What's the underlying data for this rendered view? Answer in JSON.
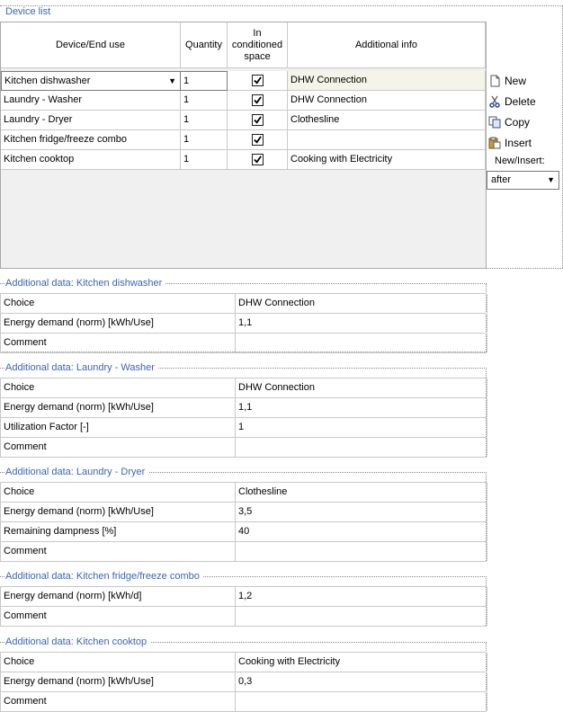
{
  "device_list": {
    "title": "Device list",
    "columns": [
      "Device/End use",
      "Quantity",
      "In conditioned space",
      "Additional info"
    ],
    "rows": [
      {
        "device": "Kitchen dishwasher",
        "quantity": "1",
        "in_conditioned_space": true,
        "info": "DHW Connection"
      },
      {
        "device": "Laundry - Washer",
        "quantity": "1",
        "in_conditioned_space": true,
        "info": "DHW Connection"
      },
      {
        "device": "Laundry - Dryer",
        "quantity": "1",
        "in_conditioned_space": true,
        "info": "Clothesline"
      },
      {
        "device": "Kitchen fridge/freeze combo",
        "quantity": "1",
        "in_conditioned_space": true,
        "info": ""
      },
      {
        "device": "Kitchen cooktop",
        "quantity": "1",
        "in_conditioned_space": true,
        "info": "Cooking with Electricity"
      }
    ]
  },
  "side": {
    "new": "New",
    "delete": "Delete",
    "copy": "Copy",
    "insert": "Insert",
    "new_insert_label": "New/Insert:",
    "new_insert_value": "after"
  },
  "sections": [
    {
      "title": "Additional data: Kitchen dishwasher",
      "rows": [
        [
          "Choice",
          "DHW Connection"
        ],
        [
          "Energy demand (norm) [kWh/Use]",
          "1,1"
        ],
        [
          "Comment",
          ""
        ]
      ]
    },
    {
      "title": "Additional data: Laundry - Washer",
      "rows": [
        [
          "Choice",
          "DHW Connection"
        ],
        [
          "Energy demand (norm) [kWh/Use]",
          "1,1"
        ],
        [
          "Utilization Factor  [-]",
          "1"
        ],
        [
          "Comment",
          ""
        ]
      ]
    },
    {
      "title": "Additional data: Laundry - Dryer",
      "rows": [
        [
          "Choice",
          "Clothesline"
        ],
        [
          "Energy demand (norm) [kWh/Use]",
          "3,5"
        ],
        [
          "Remaining dampness  [%]",
          "40"
        ],
        [
          "Comment",
          ""
        ]
      ]
    },
    {
      "title": "Additional data: Kitchen fridge/freeze combo",
      "rows": [
        [
          "Energy demand (norm) [kWh/d]",
          "1,2"
        ],
        [
          "Comment",
          ""
        ]
      ]
    },
    {
      "title": "Additional data: Kitchen cooktop",
      "rows": [
        [
          "Choice",
          "Cooking with Electricity"
        ],
        [
          "Energy demand (norm) [kWh/Use]",
          "0,3"
        ],
        [
          "Comment",
          ""
        ]
      ]
    }
  ]
}
